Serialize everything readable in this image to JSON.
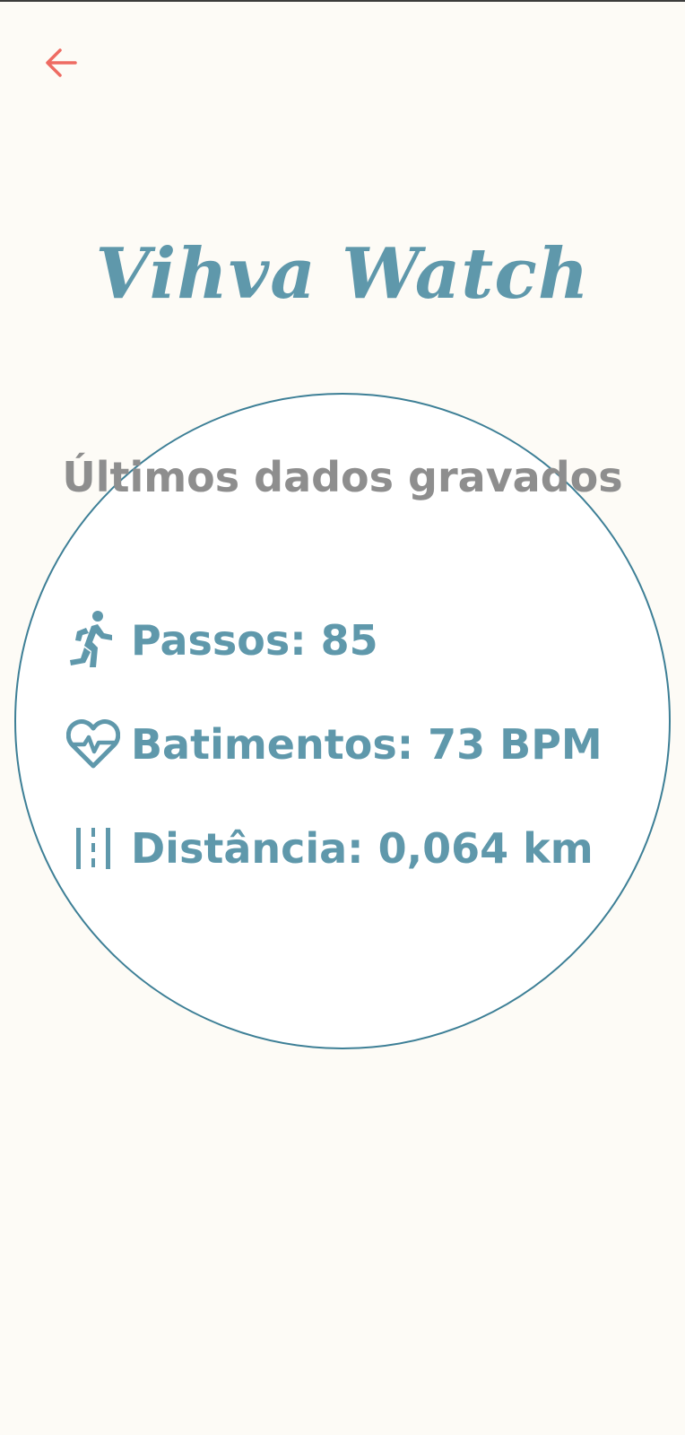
{
  "header": {
    "back_icon": "arrow-left-icon",
    "back_color": "#ee6b62"
  },
  "app": {
    "title": "Vihva Watch",
    "accent_color": "#5f98ab"
  },
  "card": {
    "heading": "Últimos dados gravados",
    "heading_color": "#8e8e8e",
    "border_color": "#3d7f96",
    "stats": [
      {
        "icon": "running-person-icon",
        "text": "Passos: 85"
      },
      {
        "icon": "heart-pulse-icon",
        "text": "Batimentos: 73 BPM"
      },
      {
        "icon": "road-distance-icon",
        "text": "Distância: 0,064 km"
      }
    ]
  }
}
